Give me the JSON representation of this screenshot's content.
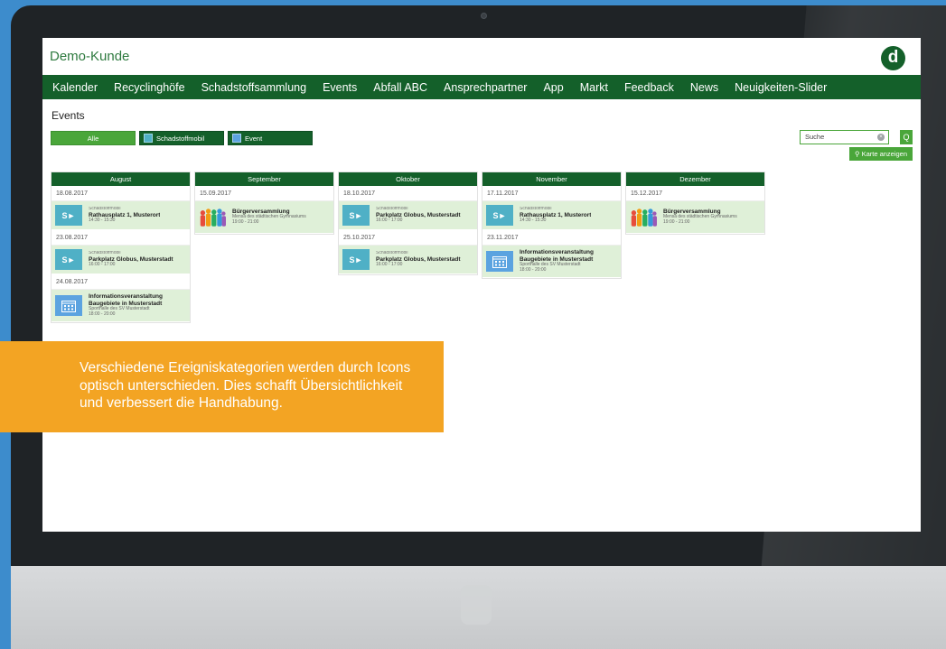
{
  "app": {
    "title": "Demo-Kunde",
    "logo_letter": "d"
  },
  "nav": [
    "Kalender",
    "Recyclinghöfe",
    "Schadstoffsammlung",
    "Events",
    "Abfall ABC",
    "Ansprechpartner",
    "App",
    "Markt",
    "Feedback",
    "News",
    "Neuigkeiten-Slider"
  ],
  "page": {
    "title": "Events"
  },
  "filters": {
    "all": "Alle",
    "mobil": "Schadstoffmobil",
    "event": "Event"
  },
  "search": {
    "placeholder": "Suche",
    "clear": "×",
    "button": "Q"
  },
  "map_button": "Karte anzeigen",
  "months": [
    {
      "name": "August",
      "days": [
        {
          "date": "18.08.2017",
          "events": [
            {
              "icon": "truck-icon",
              "cat": "Schadstoffmobil",
              "title": "Rathausplatz 1, Musterort",
              "sub": "14:30 - 15:30"
            }
          ]
        },
        {
          "date": "23.08.2017",
          "events": [
            {
              "icon": "truck-icon",
              "cat": "Schadstoffmobil",
              "title": "Parkplatz Globus, Musterstadt",
              "sub": "16:00 - 17:00"
            }
          ]
        },
        {
          "date": "24.08.2017",
          "events": [
            {
              "icon": "calendar-icon",
              "cat": "",
              "title": "Informationsveranstaltung Baugebiete in Musterstadt",
              "sub": "Sporthalle des SV Musterstadt",
              "sub2": "18:00 - 20:00"
            }
          ]
        }
      ]
    },
    {
      "name": "September",
      "days": [
        {
          "date": "15.09.2017",
          "events": [
            {
              "icon": "people-icon",
              "cat": "",
              "title": "Bürgerversammlung",
              "sub": "Mensa des städtischen Gymnasiums",
              "sub2": "19:00 - 21:00"
            }
          ]
        }
      ]
    },
    {
      "name": "Oktober",
      "days": [
        {
          "date": "18.10.2017",
          "events": [
            {
              "icon": "truck-icon",
              "cat": "Schadstoffmobil",
              "title": "Parkplatz Globus, Musterstadt",
              "sub": "16:00 - 17:00"
            }
          ]
        },
        {
          "date": "25.10.2017",
          "events": [
            {
              "icon": "truck-icon",
              "cat": "Schadstoffmobil",
              "title": "Parkplatz Globus, Musterstadt",
              "sub": "16:00 - 17:00"
            }
          ]
        }
      ]
    },
    {
      "name": "November",
      "days": [
        {
          "date": "17.11.2017",
          "events": [
            {
              "icon": "truck-icon",
              "cat": "Schadstoffmobil",
              "title": "Rathausplatz 1, Musterort",
              "sub": "14:30 - 15:30"
            }
          ]
        },
        {
          "date": "23.11.2017",
          "events": [
            {
              "icon": "calendar-icon",
              "cat": "",
              "title": "Informationsveranstaltung Baugebiete in Musterstadt",
              "sub": "Sporthalle des SV Musterstadt",
              "sub2": "18:00 - 20:00"
            }
          ]
        }
      ]
    },
    {
      "name": "Dezember",
      "days": [
        {
          "date": "15.12.2017",
          "events": [
            {
              "icon": "people-icon",
              "cat": "",
              "title": "Bürgerversammlung",
              "sub": "Mensa des städtischen Gymnasiums",
              "sub2": "19:00 - 21:00"
            }
          ]
        }
      ]
    }
  ],
  "callout": "Verschiedene Ereigniskategorien werden durch Icons optisch unterschieden. Dies schafft Übersichtlichkeit und verbessert die Handhabung.",
  "colors": {
    "brand_green": "#14602a",
    "accent_green": "#4aa63a",
    "event_bg": "#dff0d8",
    "callout": "#f3a423",
    "background": "#3d8ccc"
  }
}
